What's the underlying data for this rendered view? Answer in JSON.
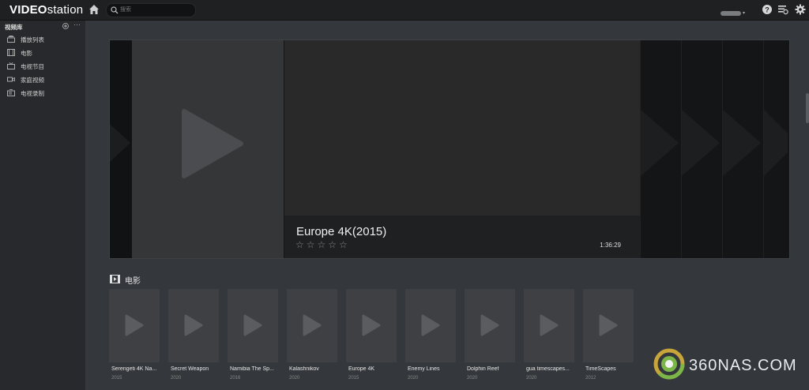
{
  "app": {
    "logo_bold": "VIDEO",
    "logo_light": "station"
  },
  "topbar": {
    "search_placeholder": "搜索",
    "icons": [
      "home-icon",
      "search-icon",
      "help-icon",
      "task-icon",
      "settings-icon"
    ]
  },
  "sidebar": {
    "header": "视频库",
    "items": [
      {
        "label": "播放列表",
        "icon": "playlist-icon"
      },
      {
        "label": "电影",
        "icon": "movie-icon"
      },
      {
        "label": "电视节目",
        "icon": "tv-icon"
      },
      {
        "label": "家庭视频",
        "icon": "camera-icon"
      },
      {
        "label": "电视录制",
        "icon": "record-icon"
      }
    ]
  },
  "hero": {
    "title": "Europe 4K(2015)",
    "rating_stars": "☆☆☆☆☆",
    "duration": "1:36:29"
  },
  "section": {
    "title": "电影"
  },
  "movies": [
    {
      "title": "Serengeti 4K Na...",
      "year": "2015"
    },
    {
      "title": "Secret Weapon",
      "year": "2020"
    },
    {
      "title": "Namibia The Sp...",
      "year": "2016"
    },
    {
      "title": "Kalashnikov",
      "year": "2020"
    },
    {
      "title": "Europe 4K",
      "year": "2015"
    },
    {
      "title": "Enemy Lines",
      "year": "2020"
    },
    {
      "title": "Dolphin Reef",
      "year": "2020"
    },
    {
      "title": "gua timescapes...",
      "year": "2020"
    },
    {
      "title": "TimeScapes",
      "year": "2012"
    }
  ],
  "watermark": {
    "text": "360NAS.COM"
  },
  "colors": {
    "topbar": "#1f2022",
    "sidebar": "#28292c",
    "content": "#34373b",
    "accent": "#7ab648"
  }
}
